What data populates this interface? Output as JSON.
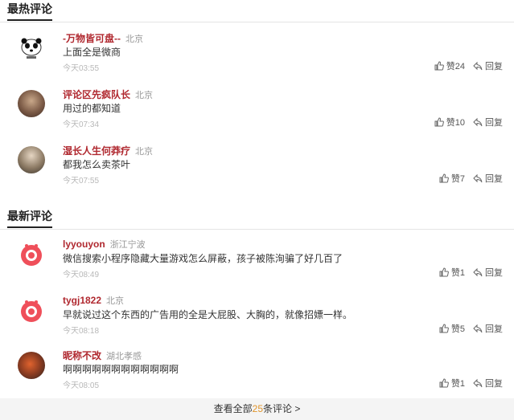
{
  "hot": {
    "title": "最热评论",
    "comments": [
      {
        "user": "-万物皆可盘--",
        "location": "北京",
        "text": "上面全是微商",
        "time": "今天03:55",
        "likes": "赞24",
        "reply": "回复"
      },
      {
        "user": "评论区先疯队长",
        "location": "北京",
        "text": "用过的都知道",
        "time": "今天07:34",
        "likes": "赞10",
        "reply": "回复"
      },
      {
        "user": "湿长人生何莽疗",
        "location": "北京",
        "text": "都我怎么卖茶叶",
        "time": "今天07:55",
        "likes": "赞7",
        "reply": "回复"
      }
    ]
  },
  "latest": {
    "title": "最新评论",
    "comments": [
      {
        "user": "lyyouyon",
        "location": "浙江宁波",
        "text": "微信搜索小程序隐藏大量游戏怎么屏蔽，孩子被陈洵骗了好几百了",
        "time": "今天08:49",
        "likes": "赞1",
        "reply": "回复"
      },
      {
        "user": "tygj1822",
        "location": "北京",
        "text": "早就说过这个东西的广告用的全是大屁股、大胸的，就像招嫖一样。",
        "time": "今天08:18",
        "likes": "赞5",
        "reply": "回复"
      },
      {
        "user": "昵称不改",
        "location": "湖北孝感",
        "text": "啊啊啊啊啊啊啊啊啊啊啊啊",
        "time": "今天08:05",
        "likes": "赞1",
        "reply": "回复"
      }
    ]
  },
  "footer": {
    "prefix": "查看全部",
    "count": "25",
    "suffix": "条评论 >"
  },
  "colors": {
    "username": "#b0282f",
    "accent": "#e0952c",
    "footer_bg": "#f4f4f4"
  }
}
